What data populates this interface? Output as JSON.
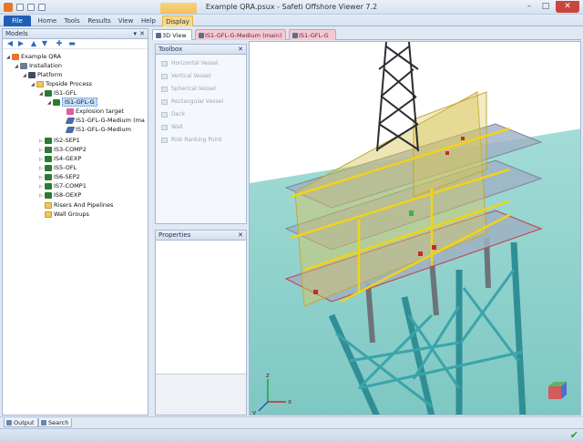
{
  "window": {
    "title": "Example QRA.psux - Safeti Offshore Viewer 7.2"
  },
  "ribbon": {
    "tabs": [
      "File",
      "Home",
      "Tools",
      "Results",
      "View",
      "Help",
      "Display"
    ],
    "context_group": "Display",
    "accent": "#1f5fb8"
  },
  "models_panel": {
    "title": "Models",
    "toolbar_icons": [
      "back-arrow-icon",
      "forward-arrow-icon",
      "up-arrow-icon",
      "down-arrow-icon",
      "expand-icon",
      "collapse-icon"
    ],
    "tree": [
      {
        "label": "Example QRA",
        "icon": "qra-icon",
        "depth": 0,
        "expander": "expanded"
      },
      {
        "label": "Installation",
        "icon": "installation-icon",
        "depth": 1,
        "expander": "expanded"
      },
      {
        "label": "Platform",
        "icon": "platform-icon",
        "depth": 2,
        "expander": "expanded"
      },
      {
        "label": "Topside Process",
        "icon": "folder-icon",
        "depth": 3,
        "expander": "expanded"
      },
      {
        "label": "IS1-GFL",
        "icon": "isolatable-section-icon",
        "depth": 4,
        "expander": "expanded"
      },
      {
        "label": "IS1-GFL-G",
        "icon": "isolatable-section-icon",
        "depth": 5,
        "expander": "expanded",
        "selected": true
      },
      {
        "label": "Explosion target",
        "icon": "explosion-target-icon",
        "depth": 6,
        "expander": "none"
      },
      {
        "label": "IS1-GFL-G-Medium (ma",
        "icon": "leak-icon",
        "depth": 6,
        "expander": "none"
      },
      {
        "label": "IS1-GFL-G-Medium",
        "icon": "leak-icon",
        "depth": 6,
        "expander": "none"
      },
      {
        "label": "IS2-SEP1",
        "icon": "isolatable-section-icon",
        "depth": 4,
        "expander": "collapsed"
      },
      {
        "label": "IS3-COMP2",
        "icon": "isolatable-section-icon",
        "depth": 4,
        "expander": "collapsed"
      },
      {
        "label": "IS4-GEXP",
        "icon": "isolatable-section-icon",
        "depth": 4,
        "expander": "collapsed"
      },
      {
        "label": "IS5-OFL",
        "icon": "isolatable-section-icon",
        "depth": 4,
        "expander": "collapsed"
      },
      {
        "label": "IS6-SEP2",
        "icon": "isolatable-section-icon",
        "depth": 4,
        "expander": "collapsed"
      },
      {
        "label": "IS7-COMP1",
        "icon": "isolatable-section-icon",
        "depth": 4,
        "expander": "collapsed"
      },
      {
        "label": "IS8-OEXP",
        "icon": "isolatable-section-icon",
        "depth": 4,
        "expander": "collapsed"
      },
      {
        "label": "Risers And Pipelines",
        "icon": "folder-icon",
        "depth": 3,
        "expander": "none"
      },
      {
        "label": "Wall Groups",
        "icon": "folder-icon",
        "depth": 3,
        "expander": "none"
      }
    ]
  },
  "toolbox": {
    "title": "Toolbox",
    "items": [
      "Horizontal Vessel",
      "Vertical Vessel",
      "Spherical Vessel",
      "Rectangular Vessel",
      "Deck",
      "Wall",
      "Risk Ranking Point"
    ]
  },
  "properties": {
    "title": "Properties"
  },
  "document_tabs": [
    {
      "label": "3D View",
      "active": true
    },
    {
      "label": "IS1-GFL-G-Medium (main)",
      "active": false
    },
    {
      "label": "IS1-GFL-G",
      "active": false
    }
  ],
  "viewport": {
    "sky_color": "#ffffff",
    "sea_color": "#8fd3cf",
    "jacket_color": "#2f8f95",
    "module_color": "#d9c55a",
    "deck_color": "#9eb0c4",
    "axis_labels": [
      "x",
      "y",
      "z"
    ]
  },
  "bottom_tabs": [
    "Output",
    "Search"
  ],
  "status": {
    "ok_icon": "checkmark-icon"
  }
}
